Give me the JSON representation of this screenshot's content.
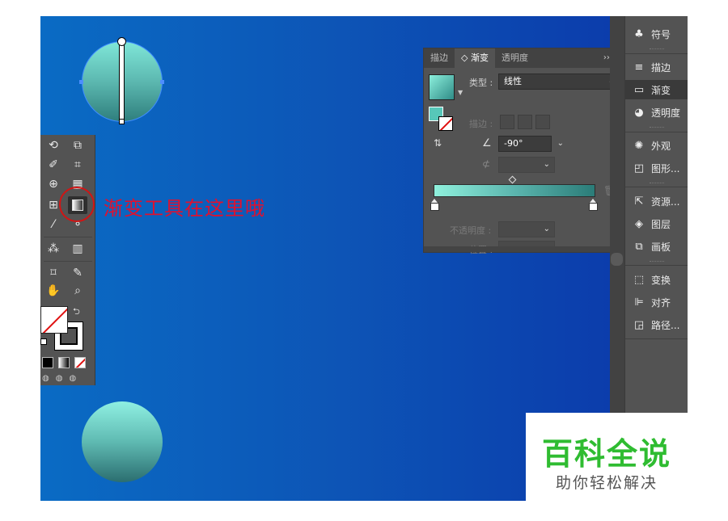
{
  "annotation": "渐变工具在这里哦",
  "gradient_panel": {
    "tabs": [
      "描边",
      "渐变",
      "透明度"
    ],
    "tab_controls": "›› | ≡",
    "type_label": "类型 :",
    "type_value": "线性",
    "stroke_label": "描边 :",
    "angle_value": "-90°",
    "opacity_label": "不透明度 :",
    "position_label": "位置 :"
  },
  "dock": {
    "items": [
      {
        "icon": "club-icon",
        "glyph": "♣",
        "label": "符号"
      },
      {
        "icon": "lines-icon",
        "glyph": "≡",
        "label": "描边"
      },
      {
        "icon": "gradient-icon",
        "glyph": "▭",
        "label": "渐变"
      },
      {
        "icon": "circles-icon",
        "glyph": "◕",
        "label": "透明度"
      },
      {
        "icon": "sun-icon",
        "glyph": "✺",
        "label": "外观"
      },
      {
        "icon": "graphic-styles-icon",
        "glyph": "◰",
        "label": "图形..."
      },
      {
        "icon": "export-icon",
        "glyph": "⇱",
        "label": "资源..."
      },
      {
        "icon": "layers-icon",
        "glyph": "◈",
        "label": "图层"
      },
      {
        "icon": "artboards-icon",
        "glyph": "⧉",
        "label": "画板"
      },
      {
        "icon": "transform-icon",
        "glyph": "⬚",
        "label": "变换"
      },
      {
        "icon": "align-icon",
        "glyph": "⊫",
        "label": "对齐"
      },
      {
        "icon": "pathfinder-icon",
        "glyph": "◲",
        "label": "路径..."
      }
    ]
  },
  "watermark": {
    "title": "百科全说",
    "subtitle": "助你轻松解决"
  },
  "colors": {
    "gradient_start": "#8ff0dc",
    "gradient_end": "#2b7c78",
    "annotation": "#e0112f",
    "brand_green": "#2fbc31"
  }
}
